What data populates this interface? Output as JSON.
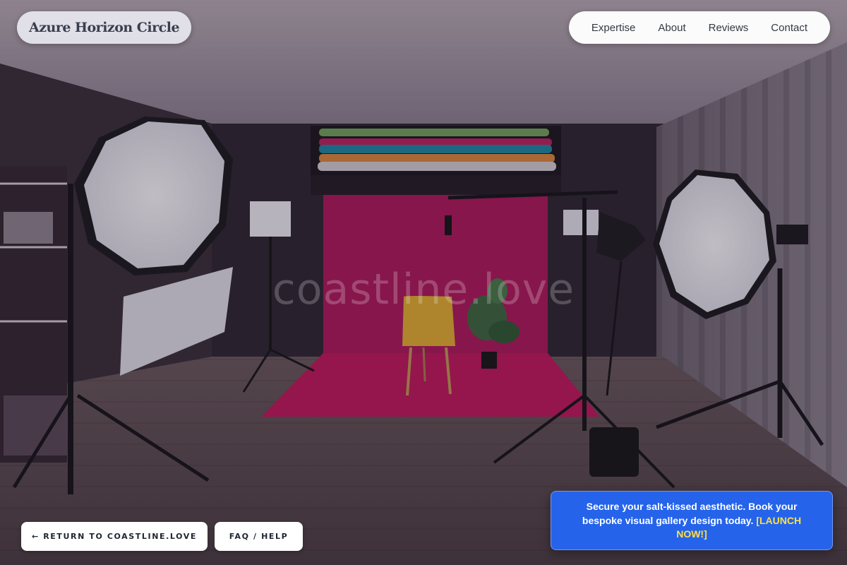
{
  "brand": {
    "name": "Azure Horizon Circle"
  },
  "nav": {
    "items": [
      "Expertise",
      "About",
      "Reviews",
      "Contact"
    ]
  },
  "watermark": "coastline.love",
  "actions": {
    "return_label": "← RETURN TO COASTLINE.LOVE",
    "faq_label": "FAQ / HELP"
  },
  "promo": {
    "text": "Secure your salt-kissed aesthetic. Book your bespoke visual gallery design today.",
    "cta": "[LAUNCH NOW!]"
  },
  "colors": {
    "backdrop": "#c2185b",
    "promo_background": "#2563eb",
    "promo_cta": "#fde047",
    "chair": "#e6b22e"
  }
}
